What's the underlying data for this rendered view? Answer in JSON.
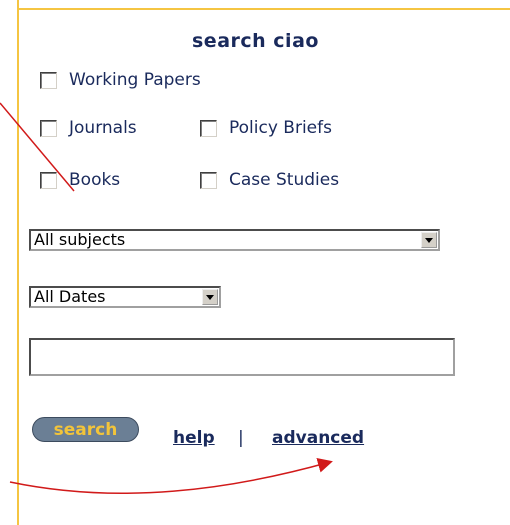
{
  "title": "search ciao",
  "checkboxes": [
    {
      "label": "Working Papers",
      "checked": false
    },
    {
      "label": "Journals",
      "checked": false
    },
    {
      "label": "Policy Briefs",
      "checked": false
    },
    {
      "label": "Books",
      "checked": false
    },
    {
      "label": "Case Studies",
      "checked": false
    }
  ],
  "subjects_select": {
    "value": "All subjects"
  },
  "dates_select": {
    "value": "All Dates"
  },
  "search_input": {
    "value": ""
  },
  "search_button": "search",
  "links": {
    "help": "help",
    "separator": "|",
    "advanced": "advanced"
  },
  "colors": {
    "border": "#f5c542",
    "text": "#1a2a5c",
    "button_bg": "#6b7f95",
    "button_text": "#f2c43a",
    "arrow": "#d11a1a"
  }
}
